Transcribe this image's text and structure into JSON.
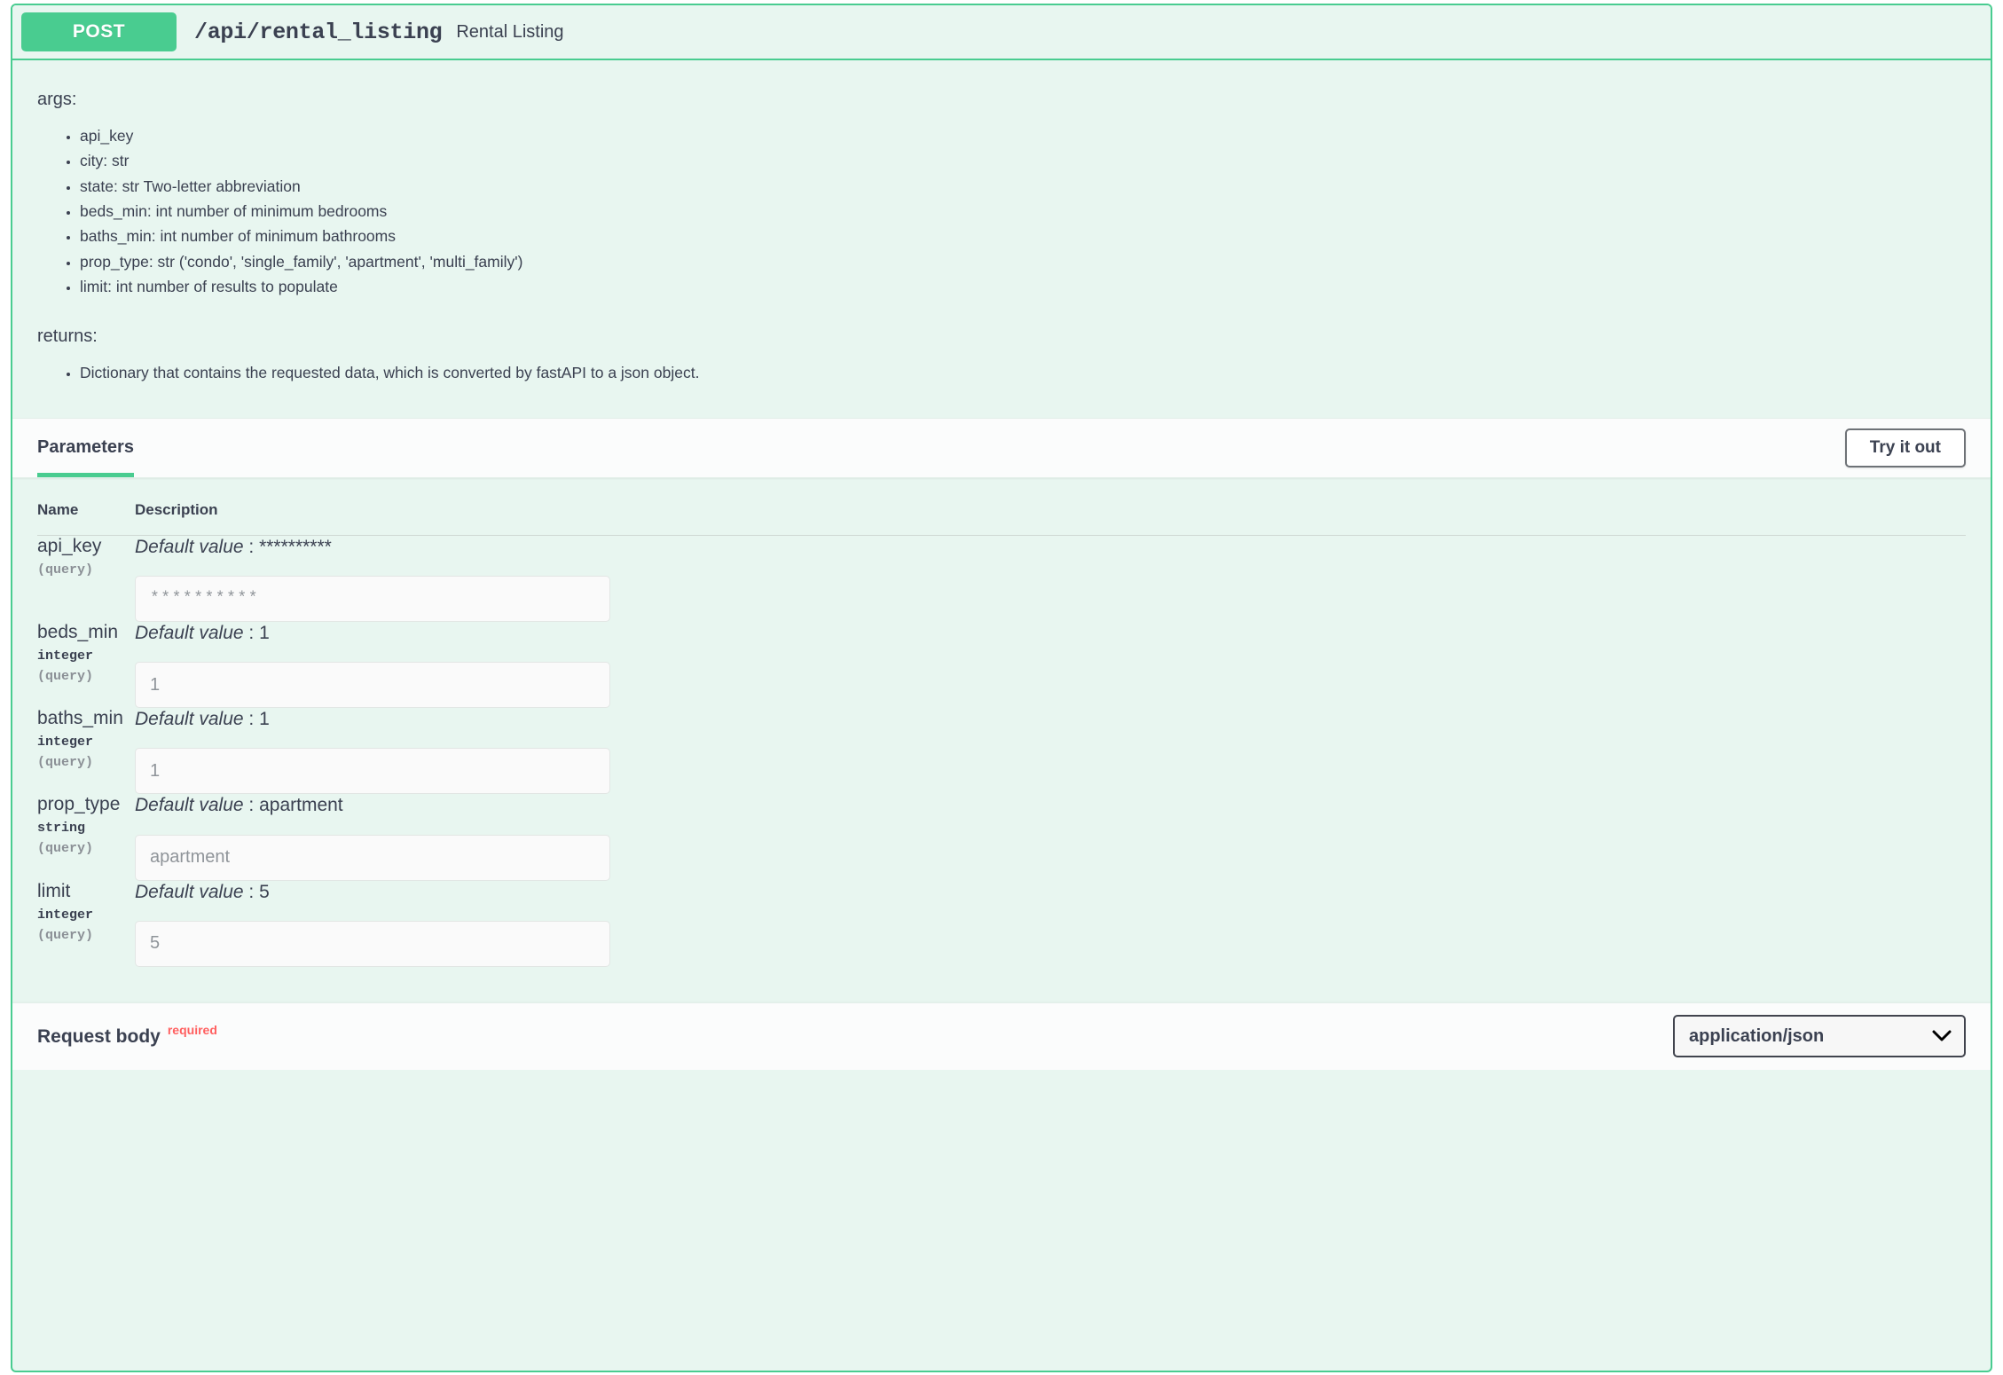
{
  "operation": {
    "method": "POST",
    "path": "/api/rental_listing",
    "summary": "Rental Listing",
    "accent_color": "#49cc90",
    "method_badge_bg": "#49cc90"
  },
  "description": {
    "args_label": "args:",
    "args_items": [
      "api_key",
      "city: str",
      "state: str Two-letter abbreviation",
      "beds_min: int number of minimum bedrooms",
      "baths_min: int number of minimum bathrooms",
      "prop_type: str ('condo', 'single_family', 'apartment', 'multi_family')",
      "limit: int number of results to populate"
    ],
    "returns_label": "returns:",
    "returns_items": [
      "Dictionary that contains the requested data, which is converted by fastAPI to a json object."
    ]
  },
  "section": {
    "tab_label": "Parameters",
    "try_it_out_label": "Try it out"
  },
  "table": {
    "header_name": "Name",
    "header_description": "Description"
  },
  "parameters": [
    {
      "name": "api_key",
      "type": "",
      "in": "(query)",
      "default_label": "Default value",
      "default_separator": ":",
      "default_value": "**********",
      "input_placeholder": "**********",
      "input_value": "",
      "masked": true
    },
    {
      "name": "beds_min",
      "type": "integer",
      "in": "(query)",
      "default_label": "Default value",
      "default_separator": ":",
      "default_value": "1",
      "input_placeholder": "1",
      "input_value": "",
      "masked": false
    },
    {
      "name": "baths_min",
      "type": "integer",
      "in": "(query)",
      "default_label": "Default value",
      "default_separator": ":",
      "default_value": "1",
      "input_placeholder": "1",
      "input_value": "",
      "masked": false
    },
    {
      "name": "prop_type",
      "type": "string",
      "in": "(query)",
      "default_label": "Default value",
      "default_separator": ":",
      "default_value": "apartment",
      "input_placeholder": "apartment",
      "input_value": "",
      "masked": false
    },
    {
      "name": "limit",
      "type": "integer",
      "in": "(query)",
      "default_label": "Default value",
      "default_separator": ":",
      "default_value": "5",
      "input_placeholder": "5",
      "input_value": "",
      "masked": false
    }
  ],
  "request_body": {
    "label": "Request body",
    "required_badge": "required",
    "required_color": "#ff6060",
    "content_type_selected": "application/json",
    "content_type_options": [
      "application/json"
    ],
    "chevron_icon": "chevron-down-icon"
  }
}
